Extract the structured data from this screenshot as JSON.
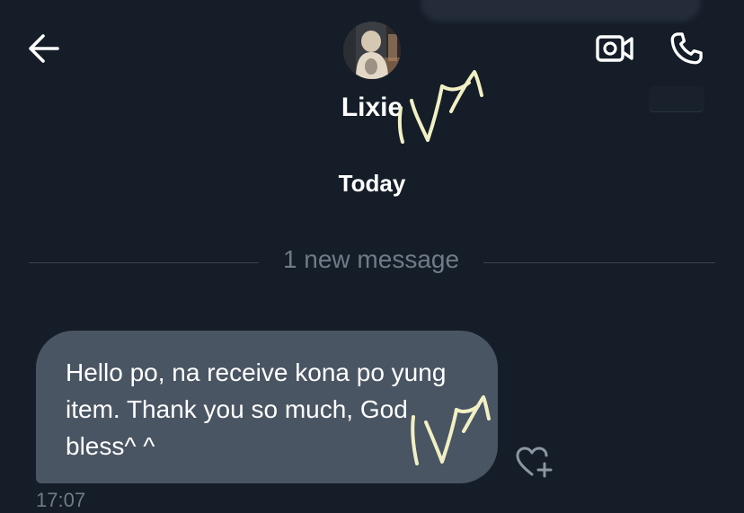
{
  "header": {
    "back_icon": "arrow-left-icon",
    "video_icon": "video-camera-icon",
    "call_icon": "phone-icon",
    "contact_name": "Lixie",
    "avatar_icon": "avatar-photo"
  },
  "conversation": {
    "date_separator": "Today",
    "new_message_label": "1 new message",
    "messages": [
      {
        "text": "Hello po, na receive kona po yung item. Thank you so much, God bless^ ^",
        "time": "17:07",
        "react_icon": "heart-plus-icon"
      }
    ]
  },
  "colors": {
    "background": "#151d28",
    "bubble": "#4a5563",
    "muted_text": "#6f7b87",
    "divider": "#38424e",
    "handwriting": "#f1f0c4"
  }
}
